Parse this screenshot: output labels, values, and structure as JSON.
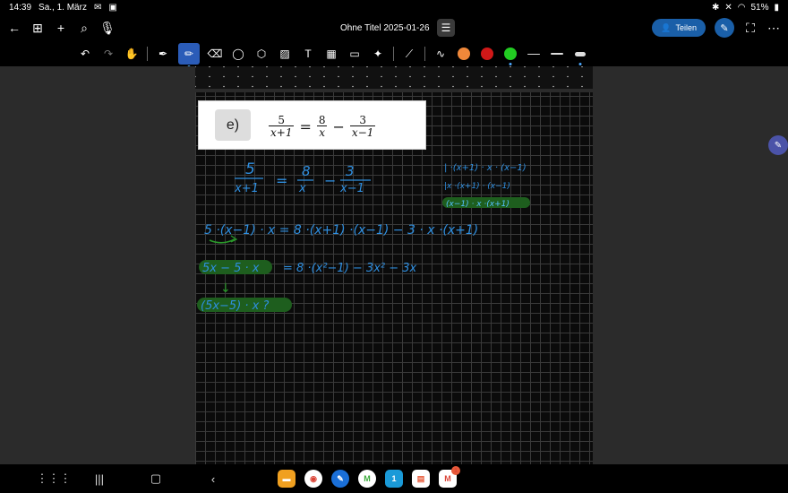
{
  "status": {
    "time": "14:39",
    "date": "Sa., 1. März",
    "battery": "51%"
  },
  "header": {
    "title": "Ohne Titel 2025-01-26",
    "share_label": "Teilen"
  },
  "problem": {
    "label": "e)",
    "lhs": {
      "num": "5",
      "den": "x+1"
    },
    "eq": "=",
    "rhs1": {
      "num": "8",
      "den": "x"
    },
    "minus": "−",
    "rhs2": {
      "num": "3",
      "den": "x−1"
    }
  },
  "handwriting": {
    "line1_frac1_num": "5",
    "line1_frac1_den": "x+1",
    "line1_eq": "=",
    "line1_frac2_num": "8",
    "line1_frac2_den": "x",
    "line1_minus": "−",
    "line1_frac3_num": "3",
    "line1_frac3_den": "x−1",
    "note1": "| ·(x+1) · x · (x−1)",
    "note2": "|x ·(x+1) · (x−1)",
    "note3": "(x−1) · x ·(x+1)",
    "line2": "5 ·(x−1) · x = 8 ·(x+1) ·(x−1) − 3 · x ·(x+1)",
    "line3_left": "5x − 5 · x",
    "line3_right": "= 8 ·(x²−1)  −  3x² − 3x",
    "arrow": "↓",
    "line4": "(5x−5) · x ?"
  },
  "colors": {
    "ink_blue": "#2f8fe0",
    "ink_green": "#2a9a2a",
    "highlight": "#1e5e1e",
    "accent": "#1a5fa8",
    "orange": "#f0883a",
    "red": "#d01818",
    "green": "#22cc22"
  }
}
